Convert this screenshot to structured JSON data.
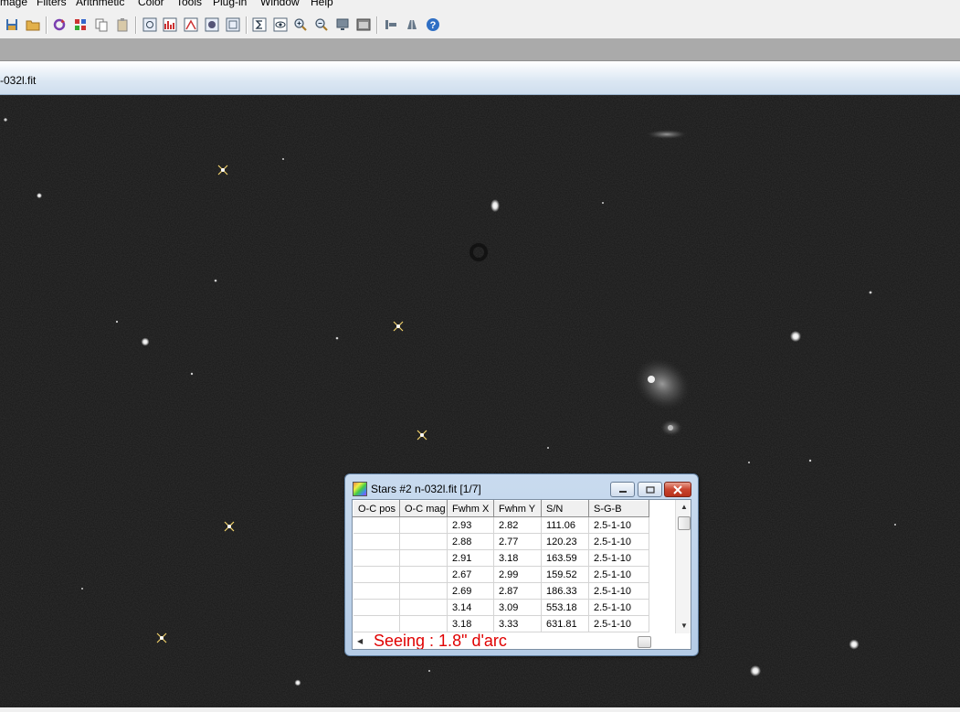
{
  "menu": [
    "mage",
    "Filters",
    "Arithmetic",
    "Color",
    "Tools",
    "Plug-in",
    "Window",
    "Help"
  ],
  "toolbar_icons": [
    "save-icon",
    "open-folder-icon",
    "refresh-icon",
    "grid-icon",
    "copy-icon",
    "paste-icon",
    "zoom-window-icon",
    "histogram-icon",
    "curve-icon",
    "circle-icon",
    "frame-icon",
    "sum-icon",
    "eye-icon",
    "zoom-in-icon",
    "zoom-out-icon",
    "monitor-icon",
    "window-icon",
    "align-icon",
    "stack-icon",
    "help-icon"
  ],
  "image_window": {
    "title": "-032l.fit"
  },
  "dialog": {
    "title": "Stars #2 n-032l.fit  [1/7]",
    "columns": [
      "O-C pos",
      "O-C mag",
      "Fwhm X",
      "Fwhm Y",
      "S/N",
      "S-G-B"
    ],
    "rows": [
      [
        "",
        "",
        "2.93",
        "2.82",
        "111.06",
        "2.5-1-10"
      ],
      [
        "",
        "",
        "2.88",
        "2.77",
        "120.23",
        "2.5-1-10"
      ],
      [
        "",
        "",
        "2.91",
        "3.18",
        "163.59",
        "2.5-1-10"
      ],
      [
        "",
        "",
        "2.67",
        "2.99",
        "159.52",
        "2.5-1-10"
      ],
      [
        "",
        "",
        "2.69",
        "2.87",
        "186.33",
        "2.5-1-10"
      ],
      [
        "",
        "",
        "3.14",
        "3.09",
        "553.18",
        "2.5-1-10"
      ],
      [
        "",
        "",
        "3.18",
        "3.33",
        "631.81",
        "2.5-1-10"
      ]
    ],
    "seeing": "Seeing : 1.8\" d'arc"
  },
  "colors": {
    "background": "#161616",
    "seeing_text": "#e00000",
    "marker": "#f3d36b"
  }
}
